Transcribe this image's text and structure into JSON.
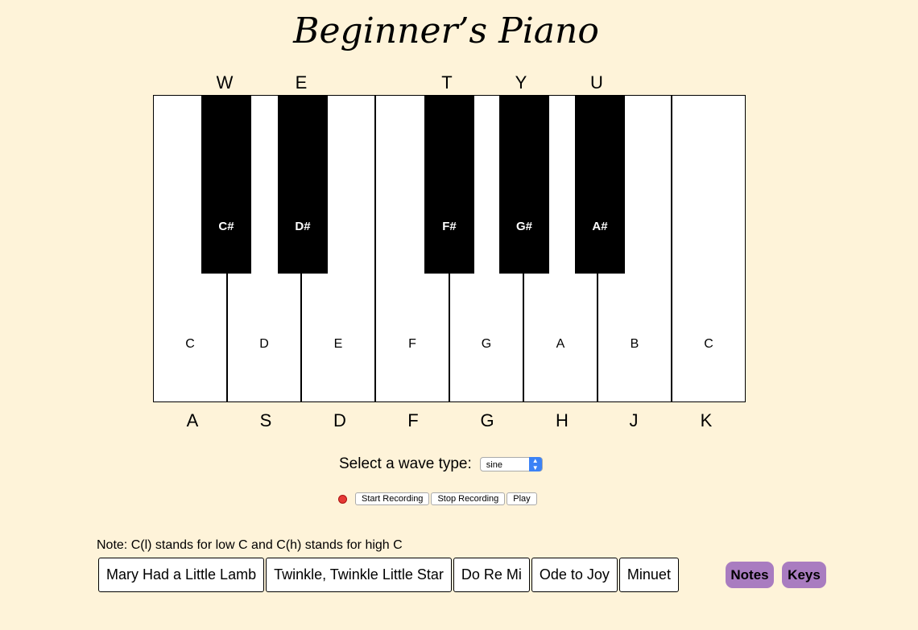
{
  "title": "Beginner’s Piano",
  "shortcuts_black": [
    "W",
    "E",
    "T",
    "Y",
    "U"
  ],
  "shortcuts_white": [
    "A",
    "S",
    "D",
    "F",
    "G",
    "H",
    "J",
    "K"
  ],
  "white_keys": [
    "C",
    "D",
    "E",
    "F",
    "G",
    "A",
    "B",
    "C"
  ],
  "black_keys": [
    "C#",
    "D#",
    "F#",
    "G#",
    "A#"
  ],
  "wave": {
    "label": "Select a wave type:",
    "selected": "sine"
  },
  "recording": {
    "start_label": "Start Recording",
    "stop_label": "Stop Recording",
    "play_label": "Play"
  },
  "note_text": "Note: C(l) stands for low C and C(h) stands for high C",
  "songs": [
    "Mary Had a Little Lamb",
    "Twinkle, Twinkle Little Star",
    "Do Re Mi",
    "Ode to Joy",
    "Minuet"
  ],
  "toggles": {
    "notes_label": "Notes",
    "keys_label": "Keys"
  },
  "colors": {
    "background": "#fef3d9",
    "toggle_purple": "#a97cc0",
    "record_dot": "#e53935",
    "select_arrow": "#3b82f6"
  }
}
